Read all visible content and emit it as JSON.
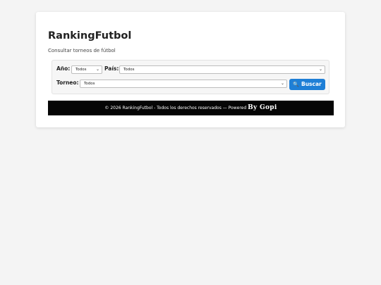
{
  "header": {
    "title": "RankingFutbol",
    "subtitle": "Consultar torneos de fútbol"
  },
  "filters": {
    "year_label": "Año:",
    "year_value": "Todos",
    "country_label": "País:",
    "country_value": "Todos",
    "tournament_label": "Torneo:",
    "tournament_value": "Todos",
    "search_button_label": "Buscar",
    "search_icon": "search-icon",
    "accent_color": "#1e7fd6"
  },
  "footer": {
    "text": "© 2026 RankingFutbol - Todos los derechos reservados — Powered",
    "brand": "By Gopi"
  }
}
